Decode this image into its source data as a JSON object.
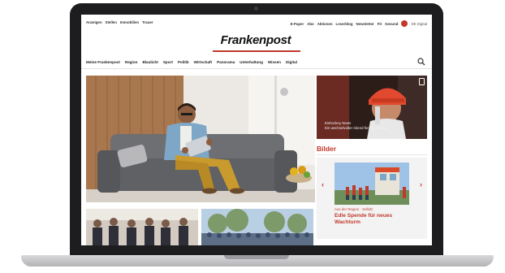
{
  "top_bar": {
    "left_links": [
      "Anzeigen",
      "Stellen",
      "Immobilien",
      "Trauer"
    ],
    "right_links": [
      "E-Paper",
      "Abo",
      "Aktionen",
      "Leserblog",
      "Newsletter",
      "Fit",
      "Gesund"
    ],
    "language": "DE Digital"
  },
  "brand": {
    "logo": "Frankenpost",
    "accent_color": "#c0392b"
  },
  "nav": {
    "items": [
      "Meine Frankenpost",
      "Region",
      "Blaulicht",
      "Sport",
      "Politik",
      "Wirtschaft",
      "Panorama",
      "Unterhaltung",
      "Wissen",
      "Digital"
    ],
    "search_icon": "search-icon"
  },
  "side_card": {
    "headline_line1": "Eishockey News",
    "headline_line2": "Ein wechselvoller Abend für die Panther",
    "icon": "bookmark-icon"
  },
  "gallery": {
    "section_title": "Bilder",
    "kicker": "Aus der Region · Selbitz",
    "headline": "Edle Spende für neues Wachturm",
    "prev_icon": "chevron-left-icon",
    "next_icon": "chevron-right-icon"
  }
}
